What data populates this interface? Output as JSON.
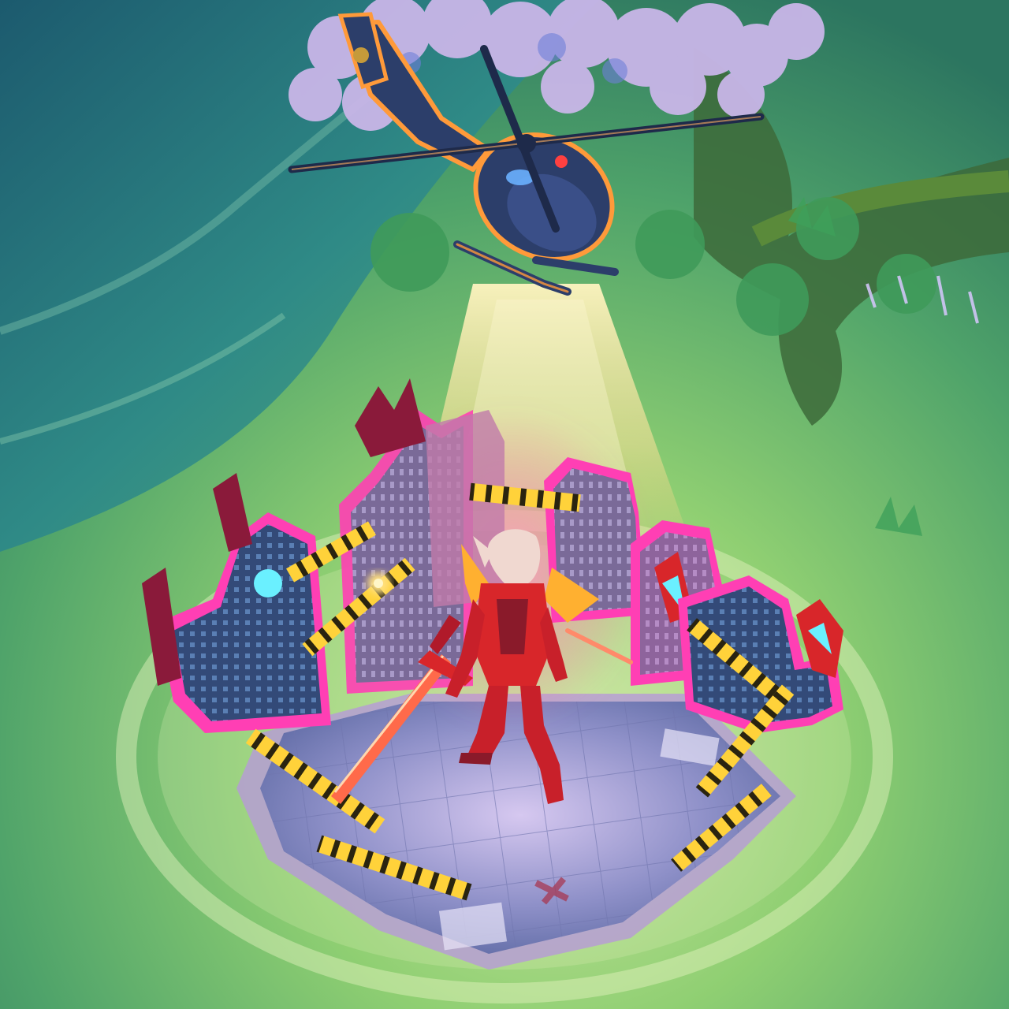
{
  "scene": {
    "kind": "game-recall-animation",
    "description_visible": "",
    "palette": {
      "water_deep": "#1d4f6a",
      "water_light": "#3a8c8a",
      "grass": "#7cc36a",
      "grass_dark": "#3f8a52",
      "platform_floor": "#8a8fc8",
      "neon_pink": "#ff3fb4",
      "tape_yellow": "#ffd23a",
      "beam_glow": "#ffe9a0",
      "helicopter_body": "#2c3e6a",
      "helicopter_outline": "#ff9a3a",
      "champion_red": "#d8262a",
      "blossom": "#c9b6e8"
    },
    "objects": {
      "helicopter": "helicopter-icon",
      "searchlight": "spotlight-beam",
      "champion": "champion-figure",
      "sword": "sword-icon",
      "buildings": "city-building-icon",
      "tape": "caution-tape",
      "tree": "blossom-tree",
      "platform": "rooftop-platform"
    }
  }
}
